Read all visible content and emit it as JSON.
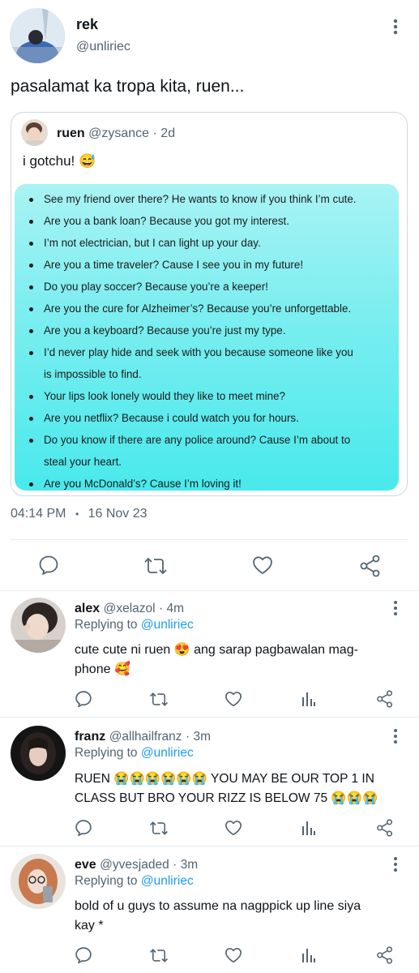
{
  "tweet": {
    "author_name": "rek",
    "author_handle": "@unliriec",
    "text": "pasalamat ka tropa kita, ruen...",
    "timestamp_time": "04:14 PM",
    "timestamp_sep": "•",
    "timestamp_date": "16 Nov 23"
  },
  "quoted": {
    "author_name": "ruen",
    "author_handle": "@zysance",
    "age": "· 2d",
    "text": "i gotchu! 😅",
    "lines": [
      {
        "bullet": true,
        "text": "See my friend over there? He wants to know if you think I’m cute."
      },
      {
        "bullet": true,
        "text": "Are you a bank loan? Because you got my interest."
      },
      {
        "bullet": true,
        "text": "I’m not electrician, but I can light up your day."
      },
      {
        "bullet": true,
        "text": "Are you a time traveler? Cause I see you in my future!"
      },
      {
        "bullet": true,
        "text": "Do you play soccer? Because you’re a keeper!"
      },
      {
        "bullet": true,
        "text": "Are you the cure for Alzheimer’s? Because you’re unforgettable."
      },
      {
        "bullet": true,
        "text": "Are you a keyboard? Because you’re just my type."
      },
      {
        "bullet": true,
        "text": "I’d never play hide and seek with you because someone like you"
      },
      {
        "bullet": false,
        "text": "is impossible to find."
      },
      {
        "bullet": true,
        "text": "Your lips look lonely would they like to meet mine?"
      },
      {
        "bullet": true,
        "text": "Are you netflix? Because i could watch you for hours."
      },
      {
        "bullet": true,
        "text": "Do you know if there are any police around? Cause I’m about to"
      },
      {
        "bullet": false,
        "text": "steal your heart."
      },
      {
        "bullet": true,
        "text": "Are you McDonald’s? Cause I’m loving it!"
      }
    ]
  },
  "replies": [
    {
      "name": "alex",
      "handle": "@xelazol",
      "age": "· 4m",
      "replying_prefix": "Replying to",
      "replying_to": "@unliriec",
      "text_line1": "cute cute ni ruen 😍 ang sarap pagbawalan mag-",
      "text_line2": "phone 🥰"
    },
    {
      "name": "franz",
      "handle": "@allhailfranz",
      "age": "· 3m",
      "replying_prefix": "Replying to",
      "replying_to": "@unliriec",
      "text_line1": "RUEN 😭😭😭😭😭😭 YOU MAY BE OUR TOP 1 IN",
      "text_line2": "CLASS BUT BRO YOUR RIZZ IS BELOW 75 😭😭😭"
    },
    {
      "name": "eve",
      "handle": "@yvesjaded",
      "age": "· 3m",
      "replying_prefix": "Replying to",
      "replying_to": "@unliriec",
      "text_line1": "bold of u guys to assume na nagppick up line siya",
      "text_line2": "kay *"
    }
  ],
  "icons": {
    "more": "more-vertical-icon",
    "reply": "comment-icon",
    "retweet": "retweet-icon",
    "like": "heart-icon",
    "share": "share-icon",
    "views": "bar-chart-icon"
  },
  "colors": {
    "accent": "#1d9bf0",
    "muted": "#536471",
    "meme_top": "#a9f3f4",
    "meme_bottom": "#49e9ec"
  }
}
